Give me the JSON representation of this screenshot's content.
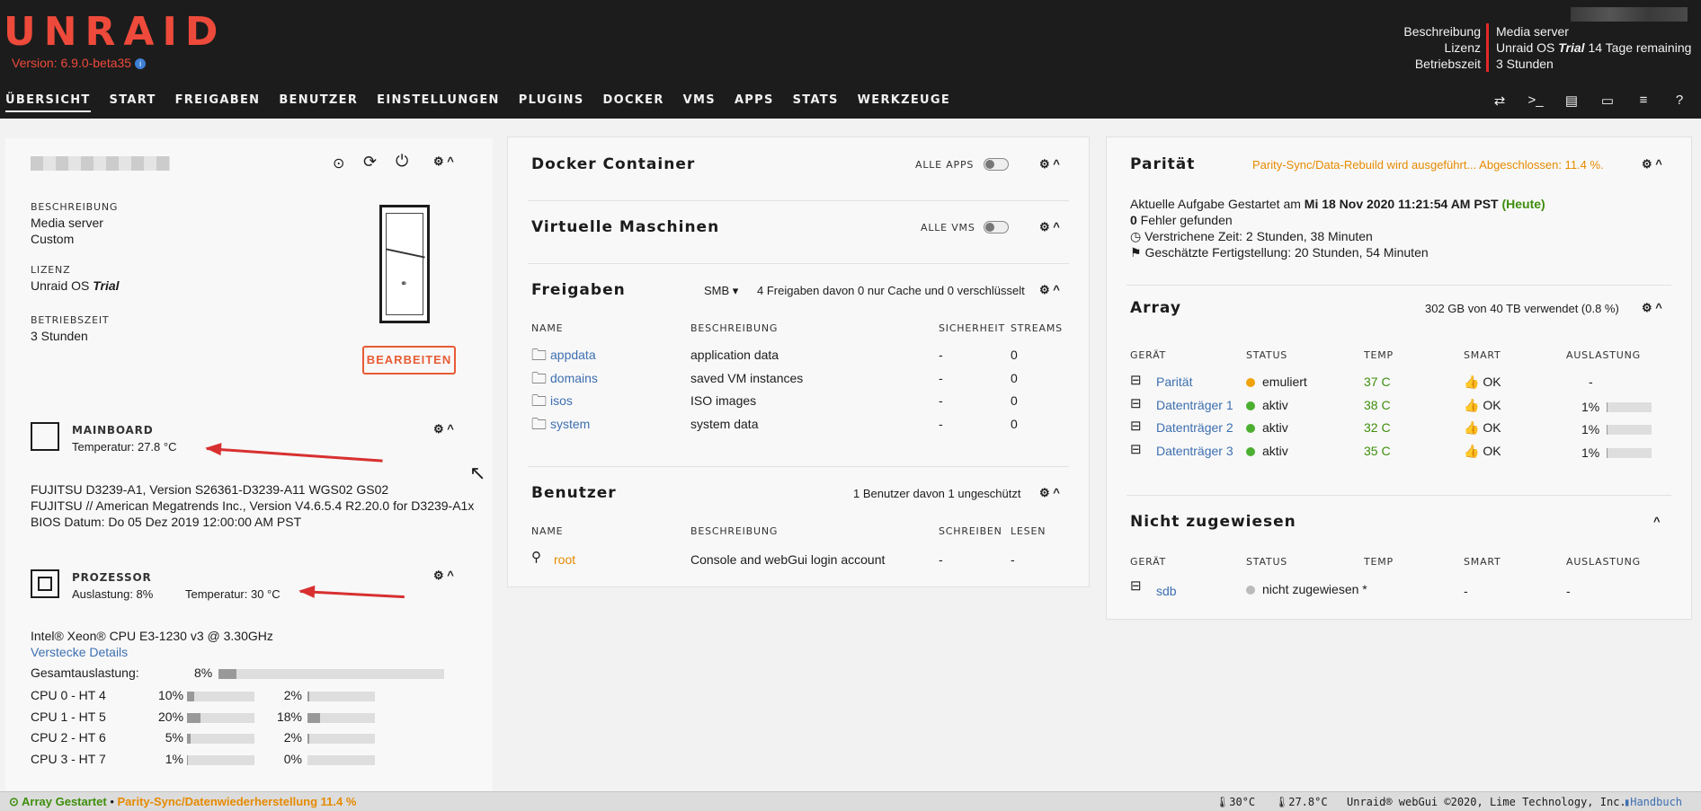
{
  "header": {
    "logo": "UNRAID",
    "version": "Version: 6.9.0-beta35",
    "info_icon": "info-icon",
    "keys": [
      "Beschreibung",
      "Lizenz",
      "Betriebszeit"
    ],
    "desc": "Media server",
    "license_a": "Unraid OS ",
    "license_b": "Trial",
    "license_c": " 14 Tage remaining",
    "uptime": "3 Stunden"
  },
  "nav": [
    "ÜBERSICHT",
    "START",
    "FREIGABEN",
    "BENUTZER",
    "EINSTELLUNGEN",
    "PLUGINS",
    "DOCKER",
    "VMS",
    "APPS",
    "STATS",
    "WERKZEUGE"
  ],
  "nav_icons": [
    "switch-icon",
    "terminal-icon",
    "feedback-icon",
    "monitor-icon",
    "log-icon",
    "help-icon"
  ],
  "server": {
    "beschreibung_l": "BESCHREIBUNG",
    "beschreibung_1": "Media server",
    "beschreibung_2": "Custom",
    "lizenz_l": "LIZENZ",
    "lizenz_a": "Unraid OS ",
    "lizenz_b": "Trial",
    "betrieb_l": "BETRIEBSZEIT",
    "betrieb": "3 Stunden",
    "edit": "BEARBEITEN"
  },
  "mainboard": {
    "title": "MAINBOARD",
    "temp": "Temperatur: 27.8 °C",
    "l1": "FUJITSU D3239-A1, Version S26361-D3239-A11 WGS02 GS02",
    "l2": "FUJITSU // American Megatrends Inc., Version V4.6.5.4 R2.20.0 for D3239-A1x",
    "l3": "BIOS Datum: Do 05 Dez 2019 12:00:00 AM PST"
  },
  "cpu": {
    "title": "PROZESSOR",
    "load": "Auslastung: 8%",
    "temp": "Temperatur: 30 °C",
    "model": "Intel® Xeon® CPU E3-1230 v3 @ 3.30GHz",
    "hide": "Verstecke Details",
    "total_l": "Gesamtauslastung:",
    "total": "8%",
    "total_frac": 0.08,
    "rows": [
      {
        "label": "CPU 0 - HT 4",
        "a": "10%",
        "af": 0.1,
        "b": "2%",
        "bf": 0.02
      },
      {
        "label": "CPU 1 - HT 5",
        "a": "20%",
        "af": 0.2,
        "b": "18%",
        "bf": 0.18
      },
      {
        "label": "CPU 2 - HT 6",
        "a": "5%",
        "af": 0.05,
        "b": "2%",
        "bf": 0.02
      },
      {
        "label": "CPU 3 - HT 7",
        "a": "1%",
        "af": 0.01,
        "b": "0%",
        "bf": 0.0
      }
    ]
  },
  "docker": {
    "title": "Docker Container",
    "all": "ALLE APPS"
  },
  "vms": {
    "title": "Virtuelle Maschinen",
    "all": "ALLE VMS"
  },
  "shares": {
    "title": "Freigaben",
    "proto": "SMB ▾",
    "summary": "4 Freigaben davon 0 nur Cache und 0 verschlüsselt",
    "cols": [
      "NAME",
      "BESCHREIBUNG",
      "SICHERHEIT",
      "STREAMS"
    ],
    "rows": [
      {
        "name": "appdata",
        "desc": "application data",
        "sec": "-",
        "str": "0"
      },
      {
        "name": "domains",
        "desc": "saved VM instances",
        "sec": "-",
        "str": "0"
      },
      {
        "name": "isos",
        "desc": "ISO images",
        "sec": "-",
        "str": "0"
      },
      {
        "name": "system",
        "desc": "system data",
        "sec": "-",
        "str": "0"
      }
    ]
  },
  "users": {
    "title": "Benutzer",
    "summary": "1 Benutzer davon 1 ungeschützt",
    "cols": [
      "NAME",
      "BESCHREIBUNG",
      "SCHREIBEN",
      "LESEN"
    ],
    "rows": [
      {
        "name": "root",
        "desc": "Console and webGui login account",
        "w": "-",
        "r": "-"
      }
    ]
  },
  "parity": {
    "title": "Parität",
    "status": "Parity-Sync/Data-Rebuild wird ausgeführt... Abgeschlossen: 11.4 %.",
    "l1a": "Aktuelle Aufgabe Gestartet am ",
    "l1b": "Mi 18 Nov 2020 11:21:54 AM PST",
    "l1c": "(Heute)",
    "l2a": "0",
    "l2b": " Fehler gefunden",
    "l3": "Verstrichene Zeit: 2 Stunden, 38 Minuten",
    "l4": "Geschätzte Fertigstellung: 20 Stunden, 54 Minuten"
  },
  "array": {
    "title": "Array",
    "used": "302 GB von 40 TB verwendet (0.8 %)",
    "cols": [
      "GERÄT",
      "STATUS",
      "TEMP",
      "SMART",
      "AUSLASTUNG"
    ],
    "rows": [
      {
        "dev": "Parität",
        "status": "emuliert",
        "color": "#f0a30a",
        "temp": "37 C",
        "smart": "OK",
        "util": "-",
        "frac": null
      },
      {
        "dev": "Datenträger 1",
        "status": "aktiv",
        "color": "#4caf30",
        "temp": "38 C",
        "smart": "OK",
        "util": "1%",
        "frac": 0.01
      },
      {
        "dev": "Datenträger 2",
        "status": "aktiv",
        "color": "#4caf30",
        "temp": "32 C",
        "smart": "OK",
        "util": "1%",
        "frac": 0.01
      },
      {
        "dev": "Datenträger 3",
        "status": "aktiv",
        "color": "#4caf30",
        "temp": "35 C",
        "smart": "OK",
        "util": "1%",
        "frac": 0.01
      }
    ]
  },
  "unassigned": {
    "title": "Nicht zugewiesen",
    "cols": [
      "GERÄT",
      "STATUS",
      "TEMP",
      "SMART",
      "AUSLASTUNG"
    ],
    "row": {
      "dev": "sdb",
      "status": "nicht zugewiesen *",
      "smart": "-",
      "util": "-"
    }
  },
  "footer": {
    "array": "Array Gestartet",
    "sep": "•",
    "parity": "Parity-Sync/Datenwiederherstellung 11.4 %",
    "t1": "30°C",
    "t2": "27.8°C",
    "copy": "Unraid® webGui ©2020, Lime Technology, Inc.",
    "manual": "Handbuch"
  }
}
